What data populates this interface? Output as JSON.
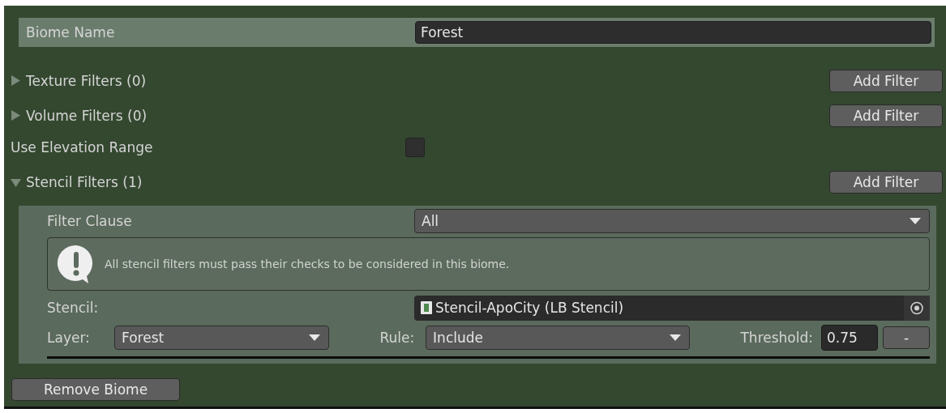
{
  "biome_name": {
    "label": "Biome Name",
    "value": "Forest"
  },
  "sections": [
    {
      "kind": "foldout",
      "label": "Texture Filters (0)",
      "expanded": false,
      "button": "Add Filter"
    },
    {
      "kind": "foldout",
      "label": "Volume Filters (0)",
      "expanded": false,
      "button": "Add Filter"
    },
    {
      "kind": "checkbox",
      "label": "Use Elevation Range",
      "checked": false
    },
    {
      "kind": "foldout",
      "label": "Stencil Filters (1)",
      "expanded": true,
      "button": "Add Filter"
    }
  ],
  "stencil_panel": {
    "filter_clause": {
      "label": "Filter Clause",
      "value": "All"
    },
    "help": "All stencil filters must pass their checks to be considered in this biome.",
    "stencil": {
      "label": "Stencil:",
      "value": "Stencil-ApoCity (LB Stencil)"
    },
    "layer": {
      "label": "Layer:",
      "value": "Forest"
    },
    "rule": {
      "label": "Rule:",
      "value": "Include"
    },
    "threshold": {
      "label": "Threshold:",
      "value": "0.75"
    },
    "remove_button": "-"
  },
  "remove_biome_button": "Remove Biome"
}
